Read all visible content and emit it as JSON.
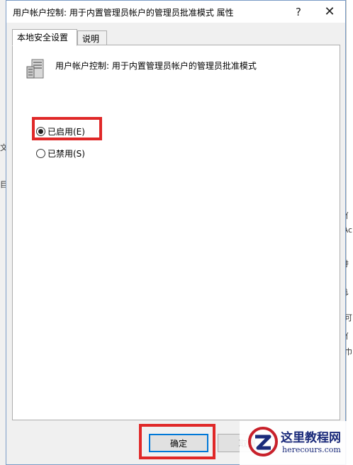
{
  "window": {
    "title": "用户帐户控制: 用于内置管理员帐户的管理员批准模式 属性",
    "help_glyph": "?",
    "close_glyph": "✕"
  },
  "tabs": [
    {
      "label": "本地安全设置",
      "active": true
    },
    {
      "label": "说明",
      "active": false
    }
  ],
  "policy": {
    "title": "用户帐户控制: 用于内置管理员帐户的管理员批准模式",
    "icon": "server-policy-icon"
  },
  "options": [
    {
      "label": "已启用(E)",
      "checked": true
    },
    {
      "label": "已禁用(S)",
      "checked": false
    }
  ],
  "buttons": {
    "ok": "确定",
    "cancel": "取消"
  },
  "background": {
    "right_chars": [
      "亻",
      "Ac",
      "扌",
      "讠",
      "可",
      "亻",
      "巾",
      "可"
    ],
    "left_chars": [
      "文",
      "目"
    ]
  },
  "watermark": {
    "title": "这里教程网",
    "url": "herecours.com"
  },
  "colors": {
    "highlight": "#e02828",
    "focus": "#0078d7"
  }
}
